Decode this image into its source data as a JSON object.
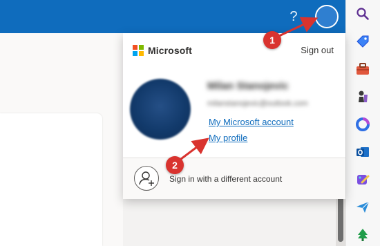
{
  "header": {
    "help_icon": "question-mark",
    "help_label": "?",
    "account_icon": "user-avatar"
  },
  "account_flyout": {
    "brand": "Microsoft",
    "sign_out": "Sign out",
    "user_name": "Milan Stanojevic",
    "user_email": "milanstanojevic@outlook.com",
    "links": [
      {
        "label": "My Microsoft account"
      },
      {
        "label": "My profile"
      }
    ],
    "switch_account": "Sign in with a different account",
    "logo_colors": [
      "#f25022",
      "#7fba00",
      "#00a4ef",
      "#ffb900"
    ]
  },
  "annotations": {
    "step1": "1",
    "step2": "2",
    "color": "#d9332f"
  },
  "sidebar": {
    "icons": [
      "search-icon",
      "tag-icon",
      "toolbox-icon",
      "chess-icon",
      "copilot-icon",
      "outlook-icon",
      "designer-icon",
      "send-icon",
      "tree-icon"
    ]
  },
  "colors": {
    "header_blue": "#0f6cbd",
    "link": "#0f6cbd"
  }
}
